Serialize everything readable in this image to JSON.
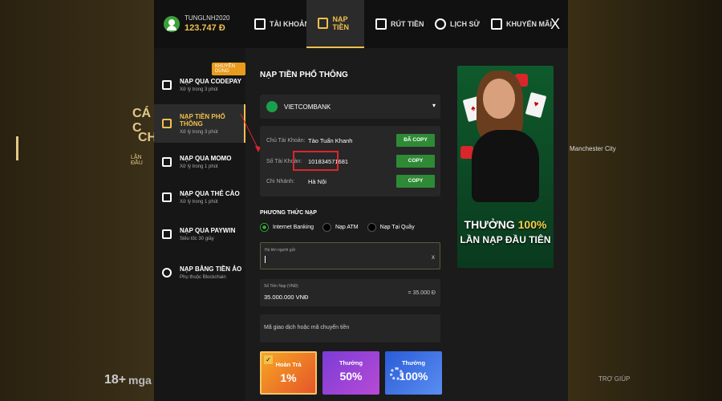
{
  "user": {
    "name": "TUNGLNH2020",
    "balance": "123.747 Đ"
  },
  "tabs": [
    {
      "label": "TÀI KHOẢN",
      "icon": "account-icon"
    },
    {
      "label": "NẠP TIỀN",
      "icon": "deposit-icon",
      "active": true
    },
    {
      "label": "RÚT TIỀN",
      "icon": "withdraw-icon"
    },
    {
      "label": "LỊCH SỬ",
      "icon": "history-icon"
    },
    {
      "label": "KHUYẾN MÃI",
      "icon": "gift-icon"
    }
  ],
  "close_label": "X",
  "sidebar": {
    "recommended_badge": "KHUYÊN DÙNG",
    "items": [
      {
        "title": "NẠP QUA CODEPAY",
        "sub": "Xử lý trong 3 phút"
      },
      {
        "title": "NẠP TIỀN PHỔ THÔNG",
        "sub": "Xử lý trong 3 phút",
        "active": true
      },
      {
        "title": "NẠP QUA MOMO",
        "sub": "Xử lý trong 1 phút"
      },
      {
        "title": "NẠP QUA THẺ CÀO",
        "sub": "Xử lý trong 1 phút"
      },
      {
        "title": "NẠP QUA PAYWIN",
        "sub": "Siêu tốc 30 giây"
      },
      {
        "title": "NẠP BẰNG TIỀN ẢO",
        "sub": "Phụ thuộc Blockchain"
      }
    ]
  },
  "main": {
    "title": "NẠP TIỀN PHỔ THÔNG",
    "bank": "VIETCOMBANK",
    "info": {
      "owner_label": "Chủ Tài Khoản:",
      "owner_value": "Tào Tuấn Khanh",
      "owner_btn": "ĐÃ COPY",
      "account_label": "Số Tài Khoản:",
      "account_value": "101834571681",
      "account_btn": "COPY",
      "branch_label": "Chi Nhánh:",
      "branch_value": "Hà Nội",
      "branch_btn": "COPY"
    },
    "method_title": "PHƯƠNG THỨC NẠP",
    "methods": [
      "Internet Banking",
      "Nạp ATM",
      "Nạp Tại Quầy"
    ],
    "sender_label": "Họ tên người gửi",
    "sender_clear": "x",
    "amount_label": "Số Tiền Nạp (VNĐ)",
    "amount_value": "35.000.000 VNĐ",
    "amount_converted": "= 35.000 Đ",
    "reference_placeholder": "Mã giao dịch hoặc mã chuyển tiền",
    "promos": [
      {
        "label": "Hoàn Trả",
        "value": "1%"
      },
      {
        "label": "Thưởng",
        "value": "50%"
      },
      {
        "label": "Thưởng",
        "value": "100%"
      }
    ]
  },
  "banner": {
    "line1_a": "THƯỞNG ",
    "line1_b": "100%",
    "line2": "LẦN NẠP ĐẦU TIÊN"
  },
  "background": {
    "left1": "CÁ C",
    "left2": "CHO",
    "left3": "LẦN ĐẦU",
    "right1": "Manchester City",
    "footer1": "18+",
    "footer2": "mga",
    "footer3": "TRỢ GIÚP"
  },
  "colors": {
    "accent": "#f0c14b",
    "copy_button": "#2f8a36",
    "highlight": "#d9272e"
  }
}
